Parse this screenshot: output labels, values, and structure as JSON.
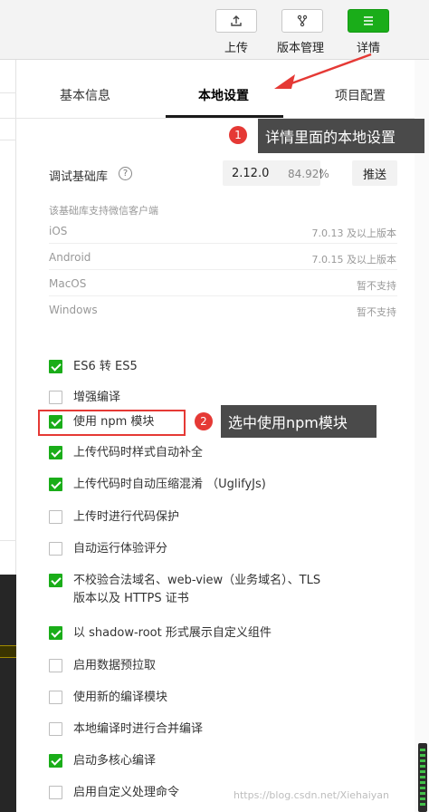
{
  "toolbar": {
    "upload_label": "上传",
    "version_label": "版本管理",
    "details_label": "详情",
    "upload_icon": "upload-icon",
    "version_icon": "branch-icon",
    "details_icon": "menu-icon"
  },
  "tabs": {
    "basic": "基本信息",
    "local": "本地设置",
    "project": "项目配置"
  },
  "debug_lib": {
    "label": "调试基础库",
    "help": "?",
    "version": "2.12.0",
    "percent": "84.92%",
    "push": "推送"
  },
  "support": {
    "note": "该基础库支持微信客户端",
    "platforms": [
      {
        "name": "iOS",
        "value": "7.0.13 及以上版本"
      },
      {
        "name": "Android",
        "value": "7.0.15 及以上版本"
      },
      {
        "name": "MacOS",
        "value": "暂不支持"
      },
      {
        "name": "Windows",
        "value": "暂不支持"
      }
    ]
  },
  "options": [
    {
      "label": "ES6 转 ES5",
      "checked": true
    },
    {
      "label": "增强编译",
      "checked": false
    },
    {
      "label": "使用 npm 模块",
      "checked": true
    },
    {
      "label": "上传代码时样式自动补全",
      "checked": true
    },
    {
      "label": "上传代码时自动压缩混淆 （UglifyJs)",
      "checked": true
    },
    {
      "label": "上传时进行代码保护",
      "checked": false
    },
    {
      "label": "自动运行体验评分",
      "checked": false
    },
    {
      "label": "不校验合法域名、web-view（业务域名）、TLS",
      "label2": "版本以及 HTTPS 证书",
      "checked": true
    },
    {
      "label": "以 shadow-root 形式展示自定义组件",
      "checked": true
    },
    {
      "label": "启用数据预拉取",
      "checked": false
    },
    {
      "label": "使用新的编译模块",
      "checked": false
    },
    {
      "label": "本地编译时进行合并编译",
      "checked": false
    },
    {
      "label": "启动多核心编译",
      "checked": true
    },
    {
      "label": "启用自定义处理命令",
      "checked": false
    }
  ],
  "annotations": {
    "badge1": "1",
    "callout1": "详情里面的本地设置",
    "badge2": "2",
    "callout2": "选中使用npm模块"
  },
  "watermark": "https://blog.csdn.net/Xiehaiyan",
  "colors": {
    "accent_green": "#1aad19",
    "annotation_red": "#e53935",
    "callout_bg": "#4a4a4a"
  }
}
